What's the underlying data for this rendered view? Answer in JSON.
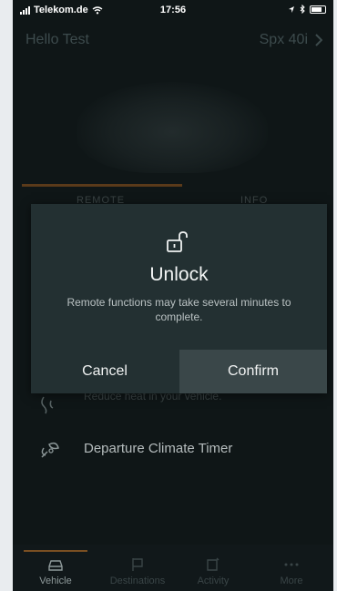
{
  "status_bar": {
    "carrier": "Telekom.de",
    "time": "17:56",
    "icons": [
      "signal-icon",
      "wifi-icon",
      "location-icon",
      "bluetooth-icon",
      "battery-icon"
    ]
  },
  "header": {
    "greeting": "Hello Test",
    "vehicle": "Spx 40i"
  },
  "tabs": [
    "REMOTE",
    "INFO"
  ],
  "list": [
    {
      "icon": "fan-heat-icon",
      "label": "Reduce heat in your vehicle."
    },
    {
      "icon": "climate-timer-icon",
      "label": "Departure Climate Timer"
    }
  ],
  "dialog": {
    "icon": "unlock-icon",
    "title": "Unlock",
    "message": "Remote functions may take several minutes to complete.",
    "cancel_label": "Cancel",
    "confirm_label": "Confirm"
  },
  "bottom_nav": [
    {
      "icon": "car-icon",
      "label": "Vehicle",
      "active": true
    },
    {
      "icon": "flag-icon",
      "label": "Destinations",
      "active": false
    },
    {
      "icon": "activity-icon",
      "label": "Activity",
      "active": false
    },
    {
      "icon": "more-icon",
      "label": "More",
      "active": false
    }
  ],
  "colors": {
    "background": "#0f1617",
    "dialog": "#233032",
    "confirm_button": "#3a4749",
    "accent": "#7a4f22"
  }
}
